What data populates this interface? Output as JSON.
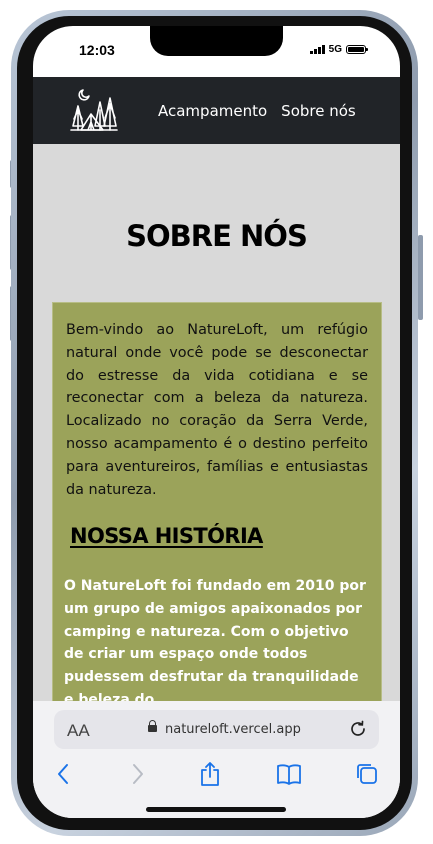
{
  "status": {
    "time": "12:03",
    "network": "5G"
  },
  "nav": {
    "links": [
      "Acampamento",
      "Sobre nós"
    ]
  },
  "page": {
    "title": "SOBRE NÓS",
    "intro": "Bem-vindo ao NatureLoft, um refúgio natural onde você pode se desconectar do estresse da vida cotidiana e se reconectar com a beleza da natureza. Localizado no coração da Serra Verde, nosso acampamento é o destino perfeito para aventureiros, famílias e entusiastas da natureza.",
    "history_title": "NOSSA HISTÓRIA",
    "history_text": "O NatureLoft foi fundado em 2010 por um grupo de amigos apaixonados por camping e natureza. Com o objetivo de criar um espaço onde todos pudessem desfrutar da tranquilidade e beleza do"
  },
  "browser": {
    "aa_label": "AA",
    "url": "natureloft.vercel.app",
    "icons": [
      "back-icon",
      "forward-icon",
      "share-icon",
      "bookmarks-icon",
      "tabs-icon",
      "reload-icon",
      "lock-icon"
    ]
  },
  "colors": {
    "navbar": "#212428",
    "background": "#d9d9d9",
    "card": "#9ba35a",
    "accent": "#1a73e8"
  }
}
